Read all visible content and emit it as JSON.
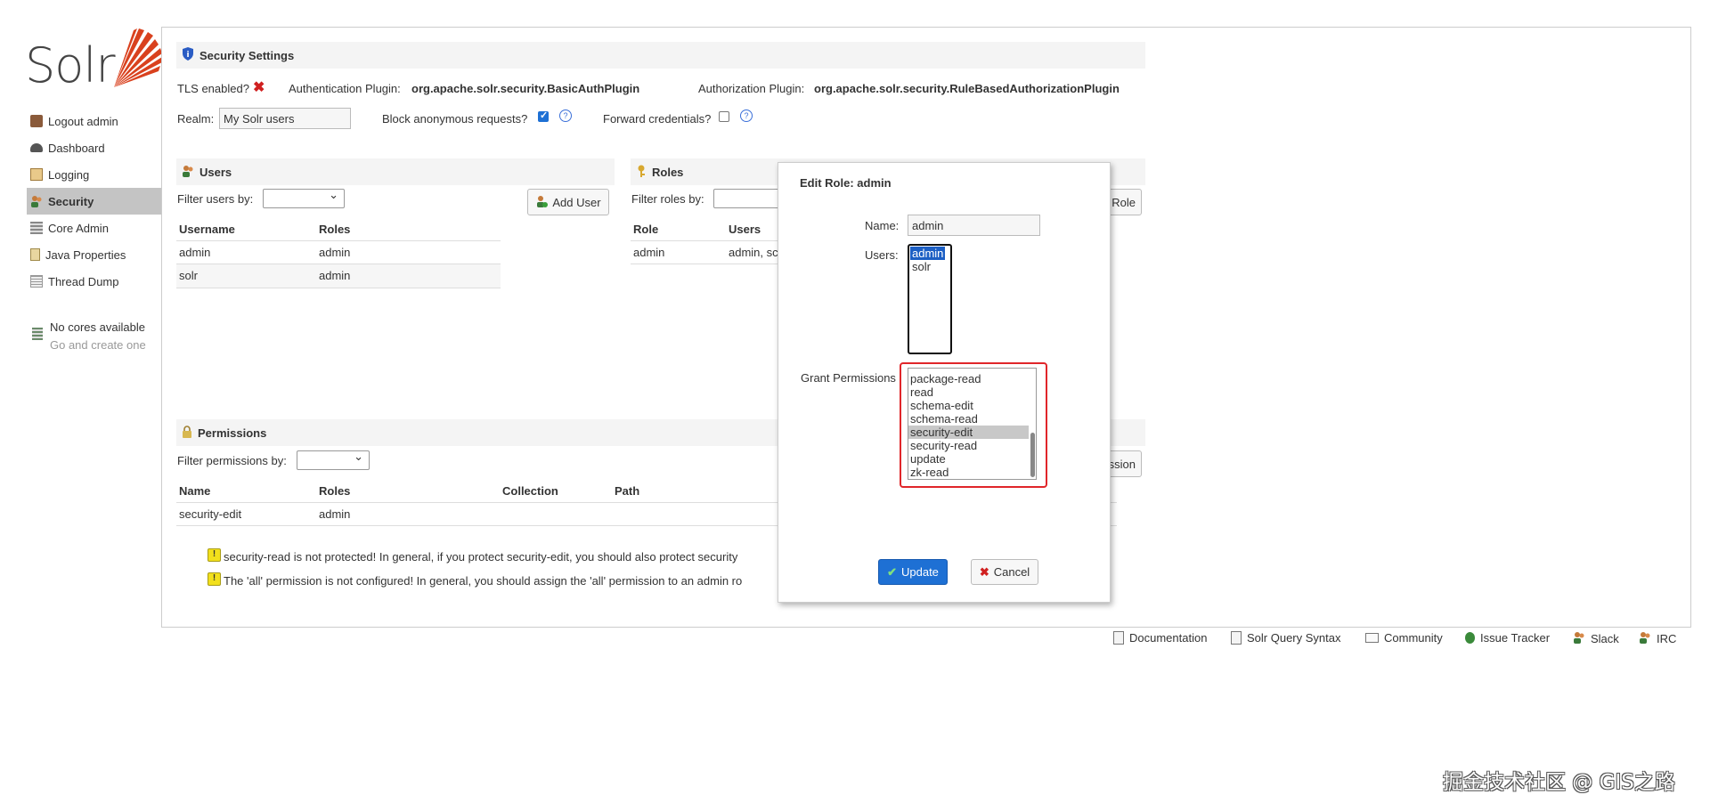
{
  "logo": {
    "text": "Solr"
  },
  "sidebar": {
    "items": [
      {
        "label": "Logout admin",
        "icon": "logout-icon"
      },
      {
        "label": "Dashboard",
        "icon": "dashboard-icon"
      },
      {
        "label": "Logging",
        "icon": "logging-icon"
      },
      {
        "label": "Security",
        "icon": "security-icon",
        "active": true
      },
      {
        "label": "Core Admin",
        "icon": "core-admin-icon"
      },
      {
        "label": "Java Properties",
        "icon": "java-properties-icon"
      },
      {
        "label": "Thread Dump",
        "icon": "thread-dump-icon"
      }
    ],
    "cores": {
      "title": "No cores available",
      "subtitle": "Go and create one"
    }
  },
  "security": {
    "title": "Security Settings",
    "tls_label": "TLS enabled?",
    "auth_plugin_label": "Authentication Plugin:",
    "auth_plugin_value": "org.apache.solr.security.BasicAuthPlugin",
    "authz_plugin_label": "Authorization Plugin:",
    "authz_plugin_value": "org.apache.solr.security.RuleBasedAuthorizationPlugin",
    "realm_label": "Realm:",
    "realm_value": "My Solr users",
    "block_anon_label": "Block anonymous requests?",
    "forward_cred_label": "Forward credentials?",
    "help_glyph": "?"
  },
  "users": {
    "title": "Users",
    "filter_label": "Filter users by:",
    "add_button": "Add User",
    "columns": [
      "Username",
      "Roles"
    ],
    "rows": [
      {
        "username": "admin",
        "roles": "admin"
      },
      {
        "username": "solr",
        "roles": "admin"
      }
    ]
  },
  "roles": {
    "title": "Roles",
    "filter_label": "Filter roles by:",
    "add_button": "Role",
    "columns": [
      "Role",
      "Users"
    ],
    "rows": [
      {
        "role": "admin",
        "users": "admin, sc"
      }
    ]
  },
  "permissions": {
    "title": "Permissions",
    "filter_label": "Filter permissions by:",
    "add_button": "ssion",
    "columns": [
      "Name",
      "Roles",
      "Collection",
      "Path"
    ],
    "rows": [
      {
        "name": "security-edit",
        "roles": "admin"
      }
    ],
    "warnings": [
      "security-read is not protected! In general, if you protect security-edit, you should also protect security",
      "The 'all' permission is not configured! In general, you should assign the 'all' permission to an admin ro"
    ],
    "warn_glyph": "!"
  },
  "modal": {
    "title": "Edit Role: admin",
    "name_label": "Name:",
    "name_value": "admin",
    "users_label": "Users:",
    "users_options": [
      "admin",
      "solr"
    ],
    "grant_label": "Grant Permissions",
    "grant_options": [
      "package-read",
      "read",
      "schema-edit",
      "schema-read",
      "security-edit",
      "security-read",
      "update",
      "zk-read"
    ],
    "grant_selected": "security-edit",
    "update_button": "Update",
    "cancel_button": "Cancel",
    "highlight_color": "#e0262a"
  },
  "footer": {
    "links": [
      {
        "label": "Documentation",
        "icon": "document-icon"
      },
      {
        "label": "Solr Query Syntax",
        "icon": "query-icon"
      },
      {
        "label": "Community",
        "icon": "mail-icon"
      },
      {
        "label": "Issue Tracker",
        "icon": "bug-icon"
      },
      {
        "label": "Slack",
        "icon": "users-icon"
      },
      {
        "label": "IRC",
        "icon": "users-icon"
      }
    ]
  },
  "watermark": "掘金技术社区 @ GIS之路",
  "colors": {
    "accent": "#1e70d4",
    "solr_orange": "#d9411e",
    "active_nav": "#c4c4c4"
  }
}
